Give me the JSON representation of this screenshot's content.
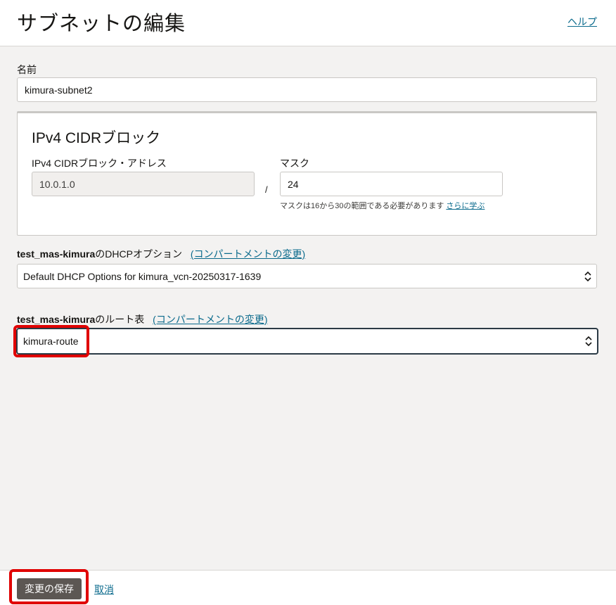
{
  "header": {
    "title": "サブネットの編集",
    "help_label": "ヘルプ"
  },
  "name_field": {
    "label": "名前",
    "value": "kimura-subnet2"
  },
  "cidr": {
    "title": "IPv4 CIDRブロック",
    "address_label": "IPv4 CIDRブロック・アドレス",
    "address_value": "10.0.1.0",
    "separator": "/",
    "mask_label": "マスク",
    "mask_value": "24",
    "mask_hint": "マスクは16から30の範囲である必要があります",
    "learn_more": "さらに学ぶ"
  },
  "dhcp": {
    "compartment": "test_mas-kimura",
    "label_suffix": "のDHCPオプション",
    "change_link": "(コンパートメントの変更)",
    "selected": "Default DHCP Options for kimura_vcn-20250317-1639"
  },
  "route": {
    "compartment": "test_mas-kimura",
    "label_suffix": "のルート表",
    "change_link": "(コンパートメントの変更)",
    "selected": "kimura-route"
  },
  "footer": {
    "save_label": "変更の保存",
    "cancel_label": "取消"
  },
  "colors": {
    "highlight": "#e00000",
    "link": "#0a6a8c",
    "primary_button": "#5c5753"
  },
  "icons": {
    "select_arrows": "chevron-up-down-icon"
  }
}
